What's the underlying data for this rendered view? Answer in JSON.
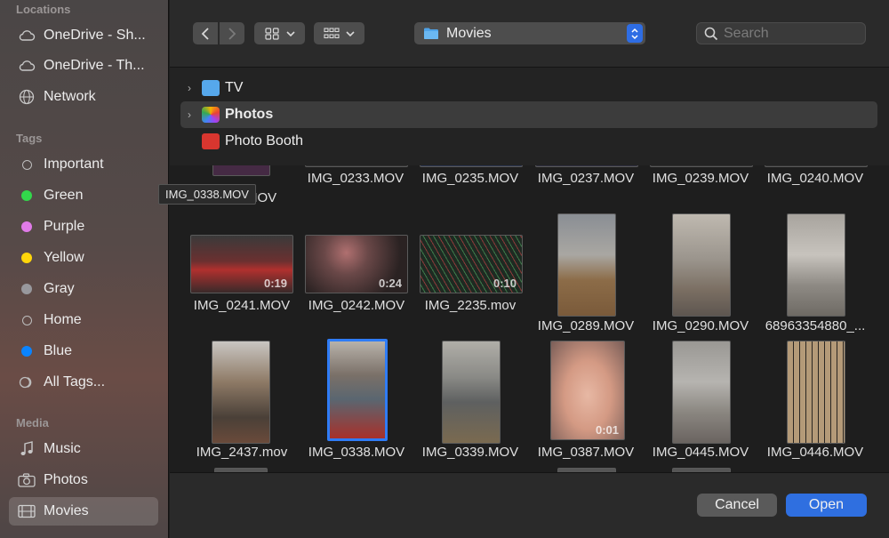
{
  "sidebar": {
    "locations_header": "Locations",
    "locations": [
      {
        "label": "OneDrive - Sh...",
        "icon": "cloud-icon"
      },
      {
        "label": "OneDrive - Th...",
        "icon": "cloud-icon"
      },
      {
        "label": "Network",
        "icon": "globe-icon"
      }
    ],
    "tags_header": "Tags",
    "tags": [
      {
        "label": "Important",
        "color": "hollow"
      },
      {
        "label": "Green",
        "color": "#32d74b"
      },
      {
        "label": "Purple",
        "color": "#e07be8"
      },
      {
        "label": "Yellow",
        "color": "#ffd60a"
      },
      {
        "label": "Gray",
        "color": "#98989d"
      },
      {
        "label": "Home",
        "color": "hollow"
      },
      {
        "label": "Blue",
        "color": "#0a84ff"
      },
      {
        "label": "All Tags...",
        "color": "all"
      }
    ],
    "media_header": "Media",
    "media": [
      {
        "label": "Music",
        "icon": "music-note-icon"
      },
      {
        "label": "Photos",
        "icon": "camera-icon"
      },
      {
        "label": "Movies",
        "icon": "film-icon",
        "selected": true
      }
    ]
  },
  "toolbar": {
    "back": "‹",
    "forward": "›",
    "location": "Movies",
    "search_placeholder": "Search"
  },
  "folders": [
    {
      "label": "TV",
      "icon": "folder-icon"
    },
    {
      "label": "Photos",
      "icon": "photos-app-icon"
    },
    {
      "label": "Photo Booth",
      "icon": "photo-booth-icon"
    }
  ],
  "tooltip": "IMG_0338.MOV",
  "grid": {
    "row0": [
      "MOV",
      "IMG_0233.MOV",
      "IMG_0235.MOV",
      "IMG_0237.MOV",
      "IMG_0239.MOV",
      "IMG_0240.MOV"
    ],
    "row1": [
      {
        "name": "IMG_0241.MOV",
        "dur": "0:19"
      },
      {
        "name": "IMG_0242.MOV",
        "dur": "0:24"
      },
      {
        "name": "IMG_2235.mov",
        "dur": "0:10"
      },
      {
        "name": "IMG_0289.MOV",
        "dur": ""
      },
      {
        "name": "IMG_0290.MOV",
        "dur": ""
      },
      {
        "name": "68963354880_...",
        "dur": ""
      }
    ],
    "row2": [
      {
        "name": "IMG_2437.mov",
        "dur": ""
      },
      {
        "name": "IMG_0338.MOV",
        "dur": ""
      },
      {
        "name": "IMG_0339.MOV",
        "dur": ""
      },
      {
        "name": "IMG_0387.MOV",
        "dur": "0:01"
      },
      {
        "name": "IMG_0445.MOV",
        "dur": ""
      },
      {
        "name": "IMG_0446.MOV",
        "dur": ""
      }
    ]
  },
  "footer": {
    "cancel": "Cancel",
    "open": "Open"
  }
}
